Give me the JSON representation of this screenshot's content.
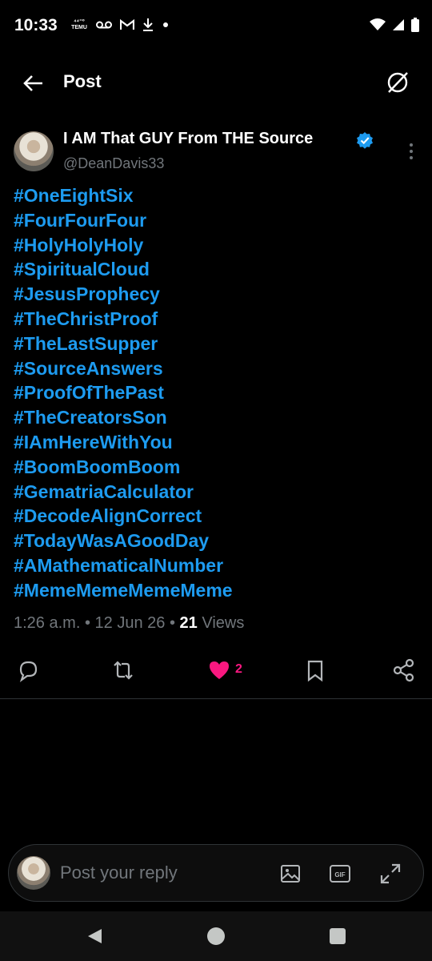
{
  "status_bar": {
    "time": "10:33",
    "left_icons": [
      "temu-icon",
      "voicemail-icon",
      "gmail-icon",
      "download-icon",
      "dot-icon"
    ],
    "temu_label": "⁴⁴⁼⁰ TEMU",
    "right_icons": [
      "wifi-icon",
      "signal-icon",
      "battery-icon"
    ]
  },
  "header": {
    "title": "Post",
    "back_icon": "arrow-left-icon",
    "grok_icon": "grok-icon"
  },
  "post": {
    "author_name": "I AM That GUY From THE Source",
    "author_handle": "@DeanDavis33",
    "verified": true,
    "hashtags": [
      "#OneEightSix",
      "#FourFourFour",
      "#HolyHolyHoly",
      "#SpiritualCloud",
      "#JesusProphecy",
      "#TheChristProof",
      "#TheLastSupper",
      "#SourceAnswers",
      "#ProofOfThePast",
      "#TheCreatorsSon",
      "#IAmHereWithYou",
      "#BoomBoomBoom",
      "#GematriaCalculator",
      "#DecodeAlignCorrect",
      "#TodayWasAGoodDay",
      "#AMathematicalNumber",
      "#MemeMemeMemeMeme"
    ],
    "time": "1:26 a.m.",
    "date": "12 Jun 26",
    "separator": "•",
    "views_count": "21",
    "views_label": "Views",
    "like_count": "2",
    "colors": {
      "hashtag": "#1d9bf0",
      "like": "#f91880",
      "muted": "#71767b"
    }
  },
  "reply": {
    "placeholder": "Post your reply",
    "icons": [
      "image-icon",
      "gif-icon",
      "expand-icon"
    ]
  },
  "nav": {
    "icons": [
      "back-triangle-icon",
      "home-circle-icon",
      "recents-square-icon"
    ]
  }
}
